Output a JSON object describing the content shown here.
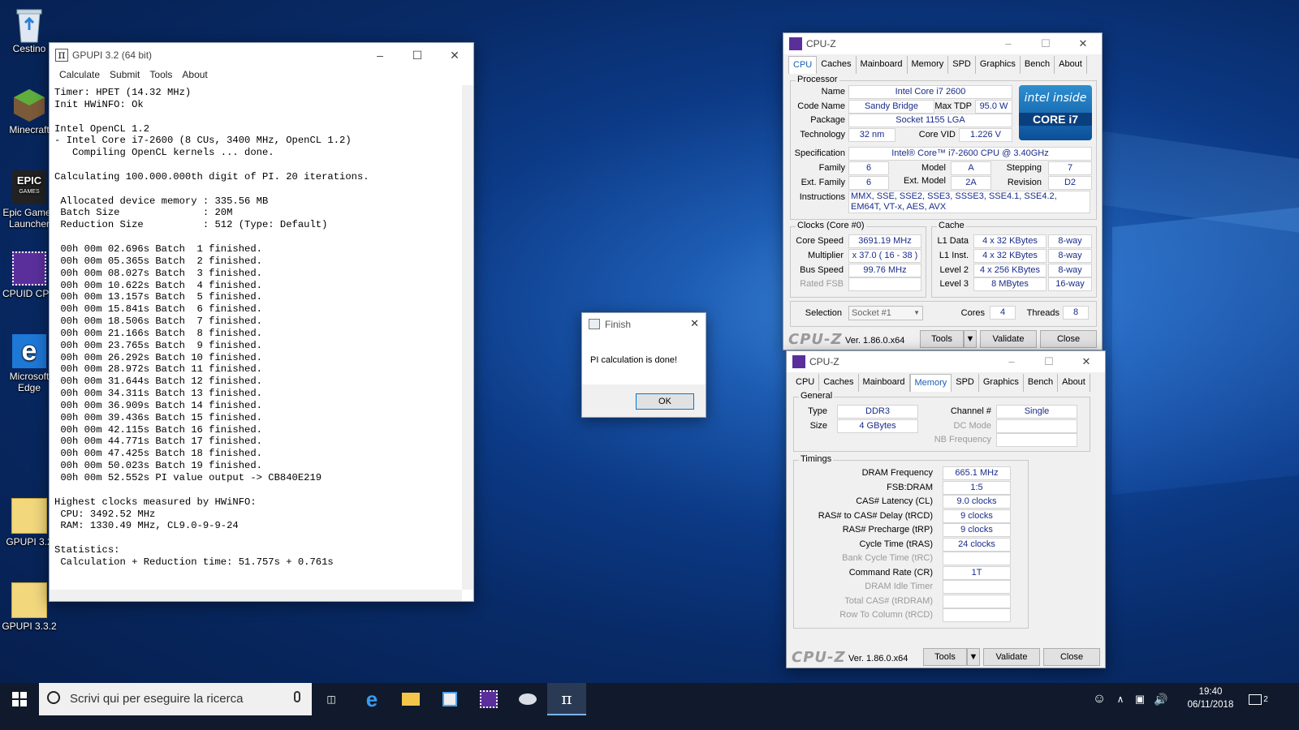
{
  "desktop": {
    "icons": [
      {
        "label": "Cestino"
      },
      {
        "label": "Minecraft"
      },
      {
        "label": "Epic Games Launcher"
      },
      {
        "label": "CPUID CPU"
      },
      {
        "label": "Microsoft Edge"
      },
      {
        "label": "GPUPI 3.2"
      },
      {
        "label": "GPUPI 3.3.2"
      }
    ]
  },
  "gpupi": {
    "title": "GPUPI 3.2 (64 bit)",
    "menu": [
      "Calculate",
      "Submit",
      "Tools",
      "About"
    ],
    "output": "Timer: HPET (14.32 MHz)\nInit HWiNFO: Ok\n\nIntel OpenCL 1.2\n- Intel Core i7-2600 (8 CUs, 3400 MHz, OpenCL 1.2)\n   Compiling OpenCL kernels ... done.\n\nCalculating 100.000.000th digit of PI. 20 iterations.\n\n Allocated device memory : 335.56 MB\n Batch Size              : 20M\n Reduction Size          : 512 (Type: Default)\n\n 00h 00m 02.696s Batch  1 finished.\n 00h 00m 05.365s Batch  2 finished.\n 00h 00m 08.027s Batch  3 finished.\n 00h 00m 10.622s Batch  4 finished.\n 00h 00m 13.157s Batch  5 finished.\n 00h 00m 15.841s Batch  6 finished.\n 00h 00m 18.506s Batch  7 finished.\n 00h 00m 21.166s Batch  8 finished.\n 00h 00m 23.765s Batch  9 finished.\n 00h 00m 26.292s Batch 10 finished.\n 00h 00m 28.972s Batch 11 finished.\n 00h 00m 31.644s Batch 12 finished.\n 00h 00m 34.311s Batch 13 finished.\n 00h 00m 36.909s Batch 14 finished.\n 00h 00m 39.436s Batch 15 finished.\n 00h 00m 42.115s Batch 16 finished.\n 00h 00m 44.771s Batch 17 finished.\n 00h 00m 47.425s Batch 18 finished.\n 00h 00m 50.023s Batch 19 finished.\n 00h 00m 52.552s PI value output -> CB840E219\n\nHighest clocks measured by HWiNFO:\n CPU: 3492.52 MHz\n RAM: 1330.49 MHz, CL9.0-9-9-24\n\nStatistics:\n Calculation + Reduction time: 51.757s + 0.761s"
  },
  "dialog": {
    "title": "Finish",
    "message": "PI calculation is done!",
    "ok": "OK"
  },
  "cpuz_tabs": [
    "CPU",
    "Caches",
    "Mainboard",
    "Memory",
    "SPD",
    "Graphics",
    "Bench",
    "About"
  ],
  "cpuz_cpu": {
    "title": "CPU-Z",
    "active_tab": "CPU",
    "processor_group": "Processor",
    "name_label": "Name",
    "name": "Intel Core i7 2600",
    "codename_label": "Code Name",
    "codename": "Sandy Bridge",
    "maxtdp_label": "Max TDP",
    "maxtdp": "95.0 W",
    "package_label": "Package",
    "package": "Socket 1155 LGA",
    "technology_label": "Technology",
    "technology": "32 nm",
    "corevid_label": "Core VID",
    "corevid": "1.226 V",
    "spec_label": "Specification",
    "spec": "Intel® Core™ i7-2600 CPU @ 3.40GHz",
    "family_label": "Family",
    "family": "6",
    "model_label": "Model",
    "model": "A",
    "stepping_label": "Stepping",
    "stepping": "7",
    "extfamily_label": "Ext. Family",
    "extfamily": "6",
    "extmodel_label": "Ext. Model",
    "extmodel": "2A",
    "revision_label": "Revision",
    "revision": "D2",
    "instructions_label": "Instructions",
    "instructions": "MMX, SSE, SSE2, SSE3, SSSE3, SSE4.1, SSE4.2, EM64T, VT-x, AES, AVX",
    "clocks_group": "Clocks (Core #0)",
    "corespeed_label": "Core Speed",
    "corespeed": "3691.19 MHz",
    "multiplier_label": "Multiplier",
    "multiplier": "x 37.0 ( 16 - 38 )",
    "busspeed_label": "Bus Speed",
    "busspeed": "99.76 MHz",
    "ratedfsb_label": "Rated FSB",
    "ratedfsb": "",
    "cache_group": "Cache",
    "l1d_label": "L1 Data",
    "l1d": "4 x 32 KBytes",
    "l1d_way": "8-way",
    "l1i_label": "L1 Inst.",
    "l1i": "4 x 32 KBytes",
    "l1i_way": "8-way",
    "l2_label": "Level 2",
    "l2": "4 x 256 KBytes",
    "l2_way": "8-way",
    "l3_label": "Level 3",
    "l3": "8 MBytes",
    "l3_way": "16-way",
    "selection_label": "Selection",
    "selection": "Socket #1",
    "cores_label": "Cores",
    "cores": "4",
    "threads_label": "Threads",
    "threads": "8",
    "intel_logo_text": "intel inside",
    "intel_logo_core": "CORE i7"
  },
  "cpuz_mem": {
    "title": "CPU-Z",
    "active_tab": "Memory",
    "general_group": "General",
    "type_label": "Type",
    "type": "DDR3",
    "size_label": "Size",
    "size": "4 GBytes",
    "channel_label": "Channel #",
    "channel": "Single",
    "dcmode_label": "DC Mode",
    "dcmode": "",
    "nbfreq_label": "NB Frequency",
    "nbfreq": "",
    "timings_group": "Timings",
    "timings": [
      {
        "label": "DRAM Frequency",
        "value": "665.1 MHz",
        "dim": false
      },
      {
        "label": "FSB:DRAM",
        "value": "1:5",
        "dim": false
      },
      {
        "label": "CAS# Latency (CL)",
        "value": "9.0 clocks",
        "dim": false
      },
      {
        "label": "RAS# to CAS# Delay (tRCD)",
        "value": "9 clocks",
        "dim": false
      },
      {
        "label": "RAS# Precharge (tRP)",
        "value": "9 clocks",
        "dim": false
      },
      {
        "label": "Cycle Time (tRAS)",
        "value": "24 clocks",
        "dim": false
      },
      {
        "label": "Bank Cycle Time (tRC)",
        "value": "",
        "dim": true
      },
      {
        "label": "Command Rate (CR)",
        "value": "1T",
        "dim": false
      },
      {
        "label": "DRAM Idle Timer",
        "value": "",
        "dim": true
      },
      {
        "label": "Total CAS# (tRDRAM)",
        "value": "",
        "dim": true
      },
      {
        "label": "Row To Column (tRCD)",
        "value": "",
        "dim": true
      }
    ]
  },
  "cpuz_footer": {
    "logo": "CPU-Z",
    "version": "Ver. 1.86.0.x64",
    "tools": "Tools",
    "validate": "Validate",
    "close": "Close"
  },
  "taskbar": {
    "search_placeholder": "Scrivi qui per eseguire la ricerca",
    "time": "19:40",
    "date": "06/11/2018",
    "notifications": "2"
  }
}
